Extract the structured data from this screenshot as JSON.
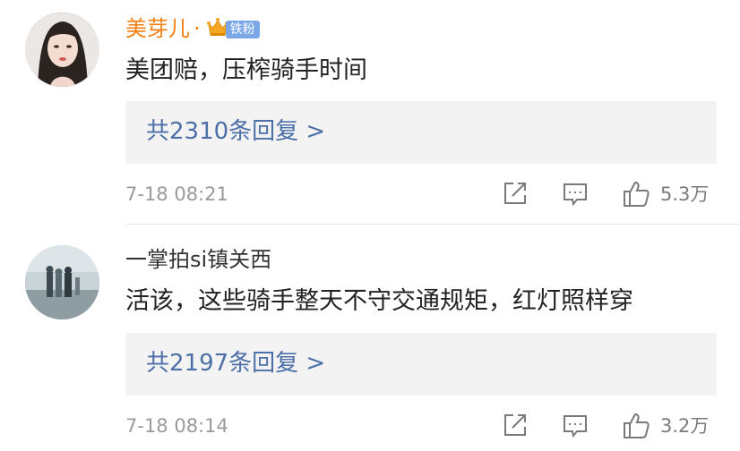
{
  "comments": [
    {
      "username": "美芽儿",
      "separator": "·",
      "badge": "铁粉",
      "text": "美团赔，压榨骑手时间",
      "replies_label": "共2310条回复 >",
      "time": "7-18 08:21",
      "likes": "5.3万",
      "name_color": "#f27f11"
    },
    {
      "username": "一掌拍si镇关西",
      "text": "活该，这些骑手整天不守交通规矩，红灯照样穿",
      "replies_label": "共2197条回复 >",
      "time": "7-18 08:14",
      "likes": "3.2万",
      "name_color": "#333333"
    }
  ],
  "colors": {
    "reply_link": "#4d6fa8",
    "reply_box": "#f3f3f3",
    "meta_gray": "#9a9a9a"
  },
  "icons": [
    "share-icon",
    "comment-icon",
    "like-icon",
    "crown-icon"
  ]
}
